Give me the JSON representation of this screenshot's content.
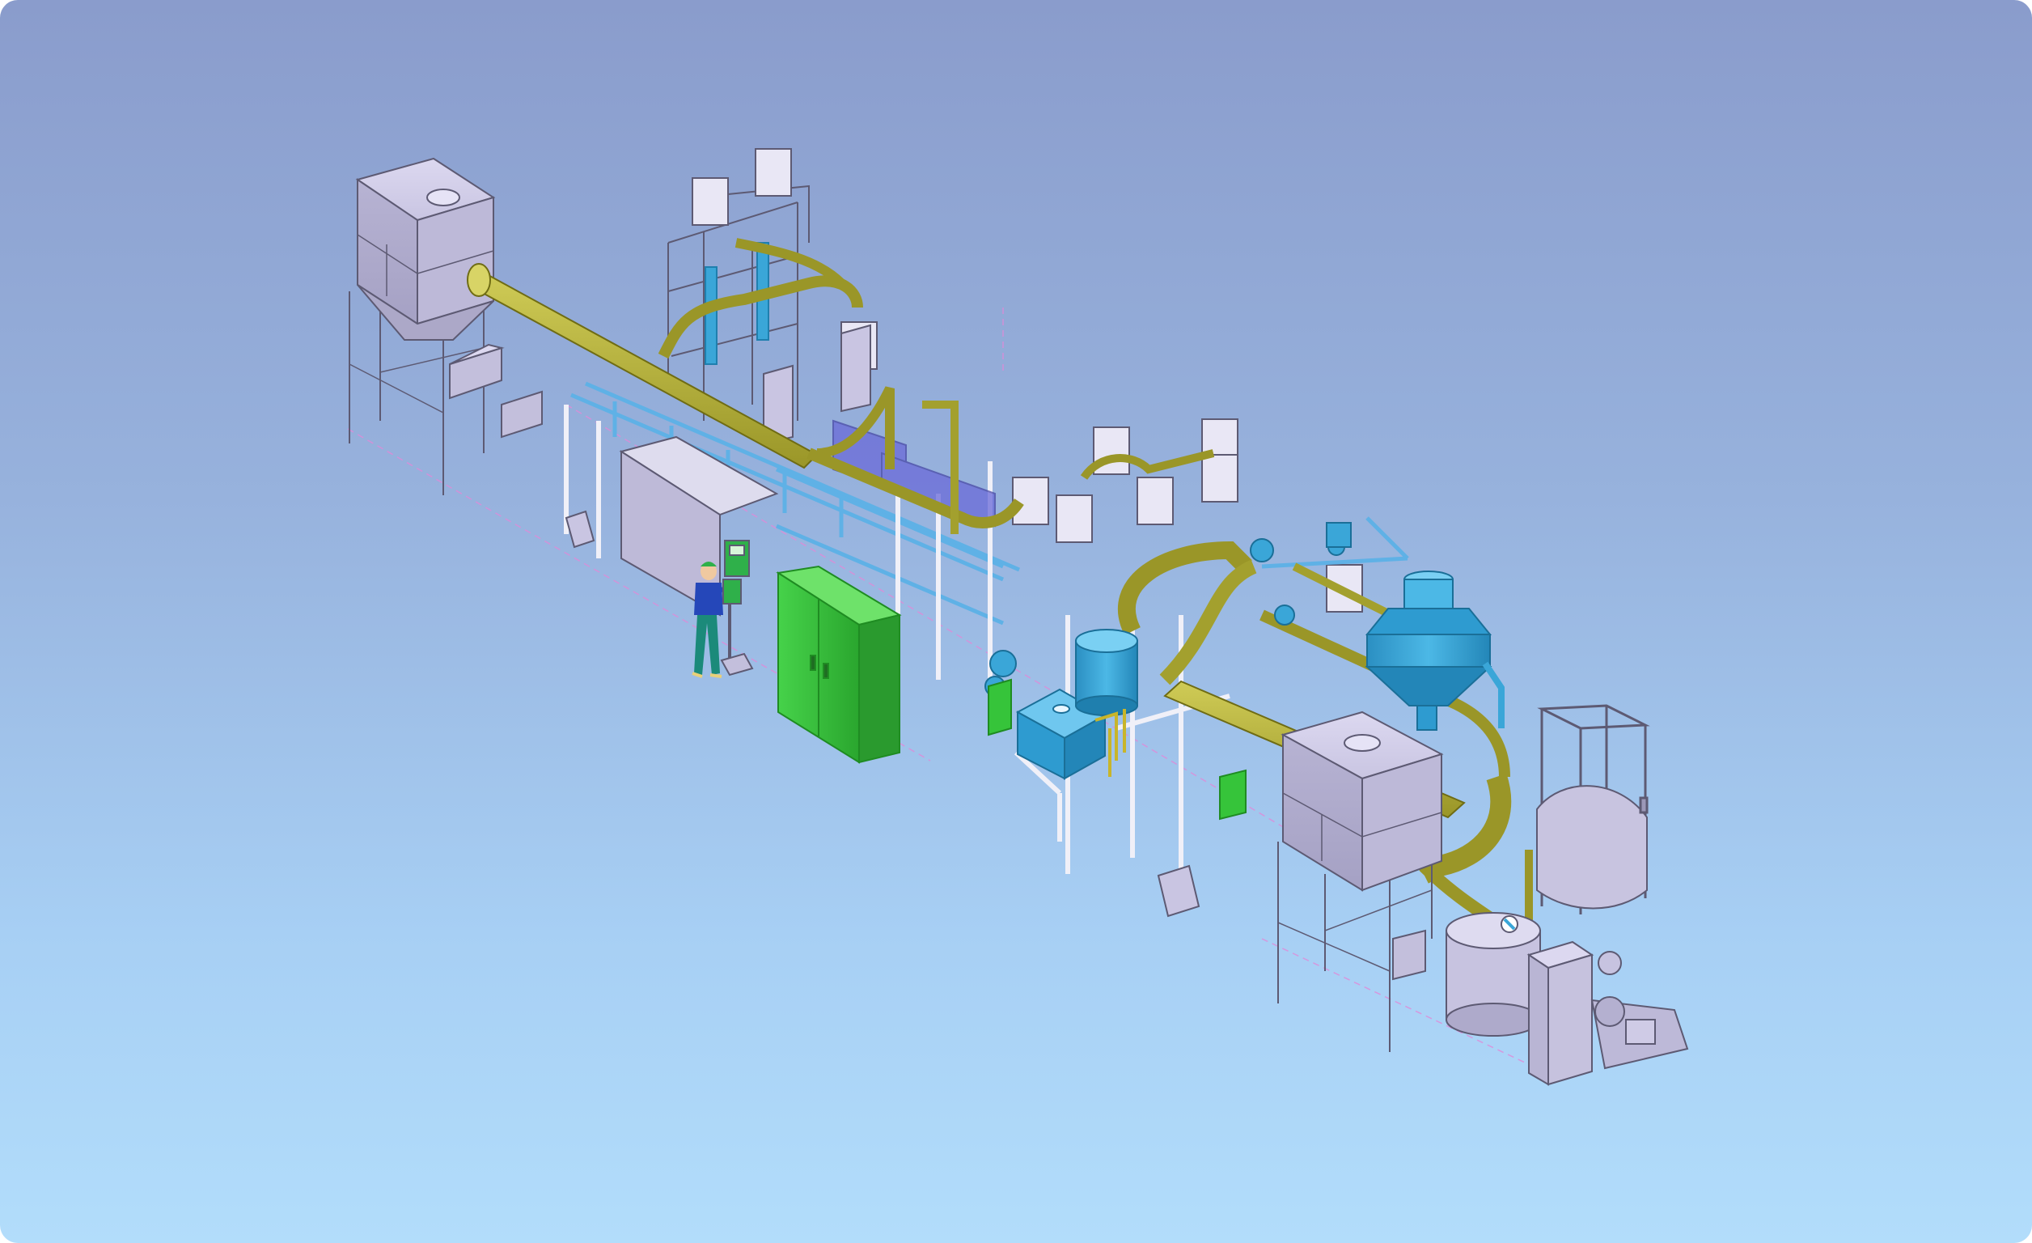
{
  "scene": {
    "description_visible_text": [],
    "palette": {
      "background_top": "#8a9ccc",
      "background_bottom": "#b2ddfb",
      "steel": "#cfcbe6",
      "steel_dark": "#9c98b8",
      "steel_edge": "#5d5a73",
      "duct_olive": "#b7b33a",
      "duct_olive_dark": "#8b8720",
      "equipment_cyan": "#3aa6d8",
      "equipment_cyan_dark": "#1f7fae",
      "frame_blue": "#5fb1e6",
      "panel_green": "#36c43a",
      "panel_green_dark": "#1f8c22",
      "control_box_green": "#2fb04a",
      "worker_shirt": "#2547b9",
      "worker_pants": "#1b8a7a",
      "dashed_guide": "#e08ad8"
    },
    "components": [
      {
        "name": "dust-collector-left",
        "label": ""
      },
      {
        "name": "main-duct",
        "label": ""
      },
      {
        "name": "cyclone-tower-left",
        "label": ""
      },
      {
        "name": "electrical-panel-green",
        "label": ""
      },
      {
        "name": "operator-worker",
        "label": ""
      },
      {
        "name": "control-box-station",
        "label": ""
      },
      {
        "name": "cyan-tank-unit",
        "label": ""
      },
      {
        "name": "cyan-silo-right",
        "label": ""
      },
      {
        "name": "dust-collector-right",
        "label": ""
      },
      {
        "name": "mixing-tank",
        "label": ""
      },
      {
        "name": "pump-skid",
        "label": ""
      },
      {
        "name": "frame-cage-right",
        "label": ""
      }
    ]
  }
}
